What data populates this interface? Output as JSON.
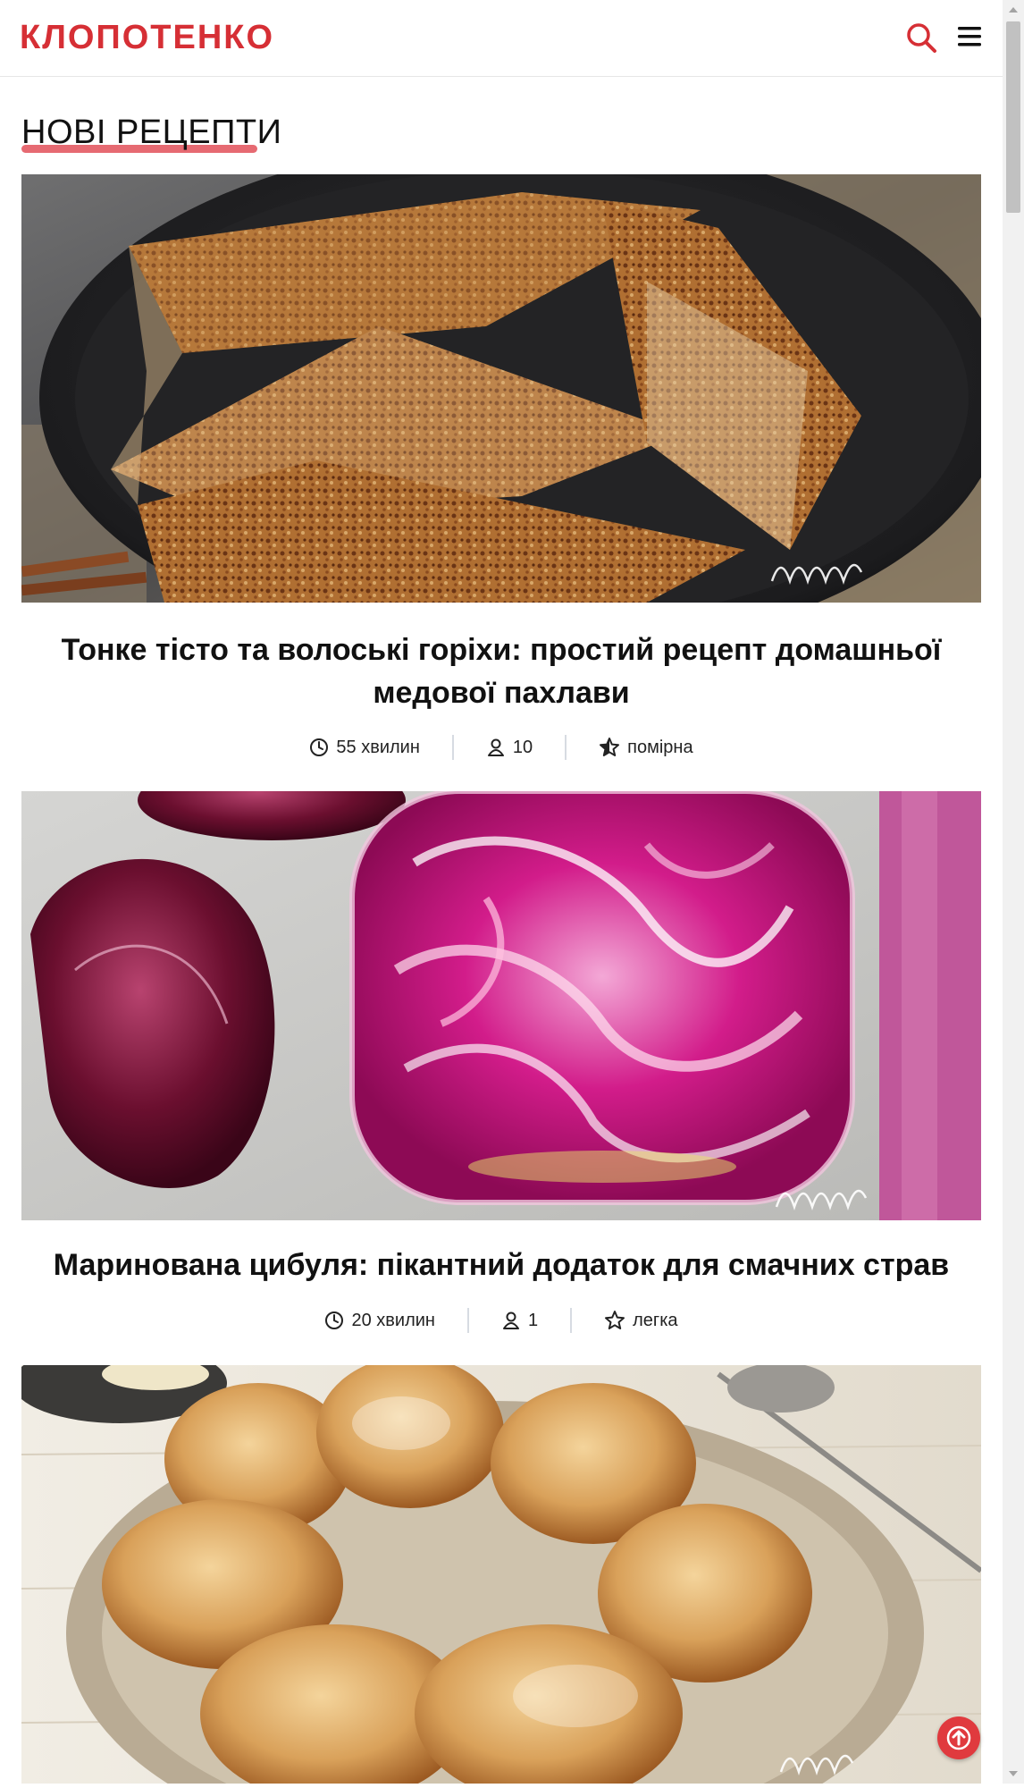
{
  "header": {
    "logo": "КЛОПОТЕНКО",
    "brand_color": "#d62f35"
  },
  "section": {
    "title": "НОВІ РЕЦЕПТИ",
    "underline_color": "#e66a72"
  },
  "recipes": [
    {
      "title": "Тонке тісто та волоські горіхи: простий рецепт домашньої медової пахлави",
      "time": "55 хвилин",
      "servings": "10",
      "difficulty": "помірна",
      "time_icon": "clock-icon",
      "servings_icon": "person-icon",
      "difficulty_icon": "half-star-icon"
    },
    {
      "title": "Маринована цибуля: пікантний додаток для смачних страв",
      "time": "20 хвилин",
      "servings": "1",
      "difficulty": "легка",
      "time_icon": "clock-icon",
      "servings_icon": "person-icon",
      "difficulty_icon": "star-outline-icon"
    },
    {
      "title": "",
      "time": "",
      "servings": "",
      "difficulty": ""
    }
  ],
  "icons": {
    "search": "search-icon",
    "menu": "hamburger-menu-icon",
    "to_top": "arrow-up-icon"
  },
  "colors": {
    "accent": "#e03a3e",
    "separator": "#d7dbe2"
  }
}
